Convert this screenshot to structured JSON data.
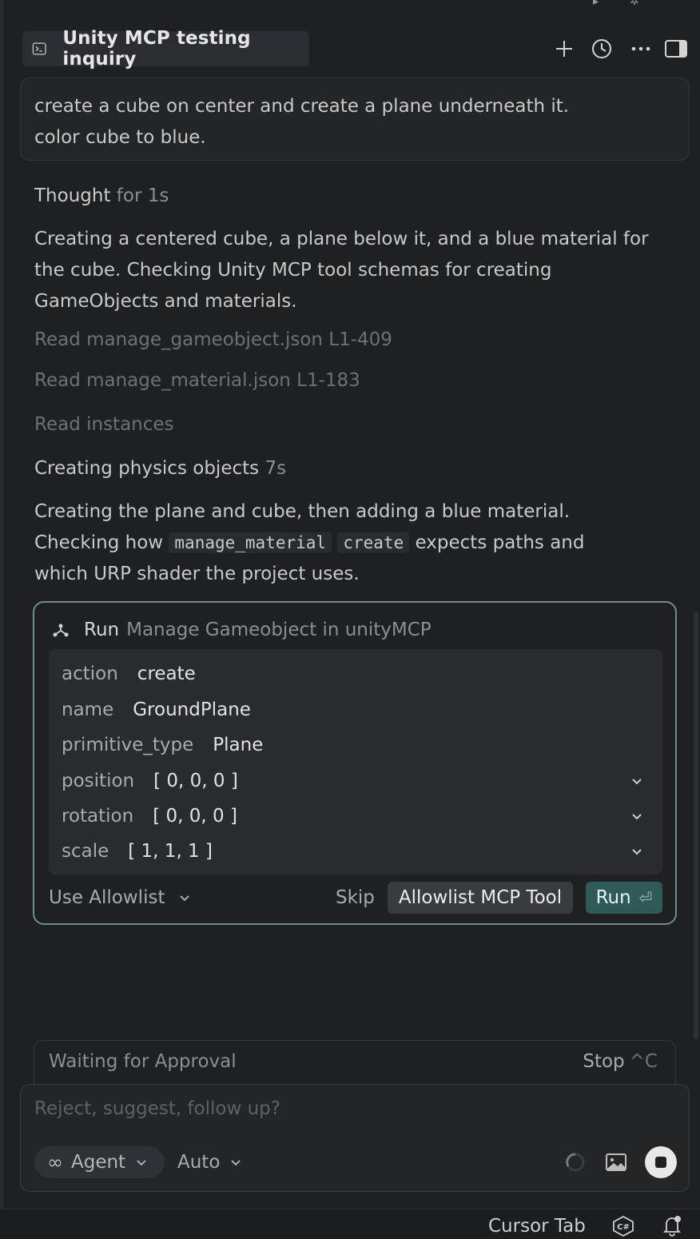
{
  "header": {
    "title": "Unity MCP testing inquiry"
  },
  "user_message": {
    "line1": "create a cube on center and create a plane underneath it.",
    "line2": "color cube to blue."
  },
  "thought": {
    "label": "Thought",
    "duration": "for 1s"
  },
  "para1": {
    "line1": "Creating a centered cube, a plane below it, and a blue material for",
    "line2": "the cube. Checking Unity MCP tool schemas for creating",
    "line3": "GameObjects and materials."
  },
  "reads": [
    {
      "verb": "Read",
      "target": "manage_gameobject.json L1-409"
    },
    {
      "verb": "Read",
      "target": "manage_material.json L1-183"
    },
    {
      "verb": "Read",
      "target": "instances"
    }
  ],
  "section": {
    "title": "Creating physics objects",
    "duration": "7s"
  },
  "para2": {
    "line1": "Creating the plane and cube, then adding a blue material.",
    "line2_a": "Checking how",
    "code1": "manage_material",
    "code2": "create",
    "line2_b": "expects paths and",
    "line3": "which URP shader the project uses."
  },
  "tool_call": {
    "run_word": "Run",
    "description": "Manage Gameobject in unityMCP",
    "params": [
      {
        "key": "action",
        "value": "create"
      },
      {
        "key": "name",
        "value": "GroundPlane"
      },
      {
        "key": "primitive_type",
        "value": "Plane"
      },
      {
        "key": "position",
        "value": "[ 0, 0, 0 ]"
      },
      {
        "key": "rotation",
        "value": "[ 0, 0, 0 ]"
      },
      {
        "key": "scale",
        "value": "[ 1, 1, 1 ]"
      }
    ],
    "allowlist_select": "Use Allowlist",
    "skip_label": "Skip",
    "allowlist_button": "Allowlist MCP Tool",
    "run_label": "Run",
    "run_shortcut": "⏎"
  },
  "waiting": {
    "label": "Waiting for Approval",
    "stop_label": "Stop",
    "stop_shortcut": "^C"
  },
  "composer": {
    "placeholder": "Reject, suggest, follow up?",
    "mode": "Agent",
    "model": "Auto"
  },
  "status_bar": {
    "cursor_tab": "Cursor Tab"
  },
  "colors": {
    "background": "#1f2022",
    "accent_border": "#6f8f84",
    "run_button": "#2f5a58"
  }
}
